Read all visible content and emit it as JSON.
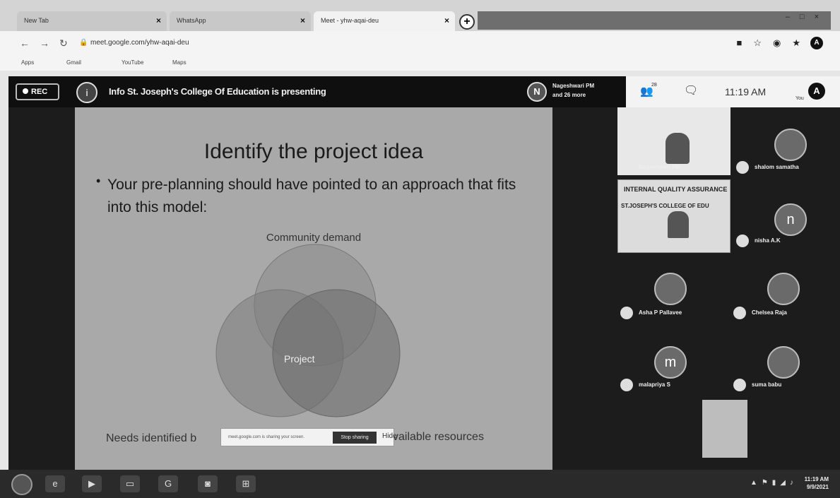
{
  "browser": {
    "tabs": [
      {
        "label": "New Tab",
        "active": false
      },
      {
        "label": "WhatsApp",
        "active": false
      },
      {
        "label": "Meet - yhw-aqai-deu",
        "active": true
      }
    ],
    "url": "meet.google.com/yhw-aqai-deu",
    "bookmarks": [
      "Apps",
      "Gmail",
      "YouTube",
      "Maps"
    ]
  },
  "meet": {
    "rec_label": "REC",
    "presenting_text": "Info St. Joseph's College Of Education is presenting",
    "presenter_initial": "i",
    "participants_name": "Nageshwari PM",
    "participants_more": "and 26 more",
    "participants_initial": "N",
    "people_count": "28",
    "time": "11:19 AM",
    "you_label": "You",
    "self_initial": "A"
  },
  "slide": {
    "title": "Identify the project idea",
    "bullet": "Your pre-planning should have pointed to an approach that fits into this model:",
    "venn_top": "Community demand",
    "venn_center": "Project",
    "bottom_left": "Needs identified b",
    "bottom_right": "vailable resources",
    "share_text": "meet.google.com is sharing your screen.",
    "share_stop": "Stop sharing",
    "share_close": "Hide"
  },
  "panel": {
    "pinned_name": "Nageshwari PM",
    "banner_line1": "INTERNAL QUALITY ASSURANCE",
    "banner_line2": "ST.JOSEPH'S COLLEGE OF EDU",
    "participants": [
      {
        "name": "shalom samatha",
        "initial": ""
      },
      {
        "name": "nisha A.K",
        "initial": "n"
      },
      {
        "name": "Asha P Pallavee",
        "initial": ""
      },
      {
        "name": "Chelsea Raja",
        "initial": ""
      },
      {
        "name": "malapriya S",
        "initial": "m"
      },
      {
        "name": "suma babu",
        "initial": ""
      }
    ]
  },
  "taskbar": {
    "time": "11:19 AM",
    "date": "9/9/2021"
  }
}
